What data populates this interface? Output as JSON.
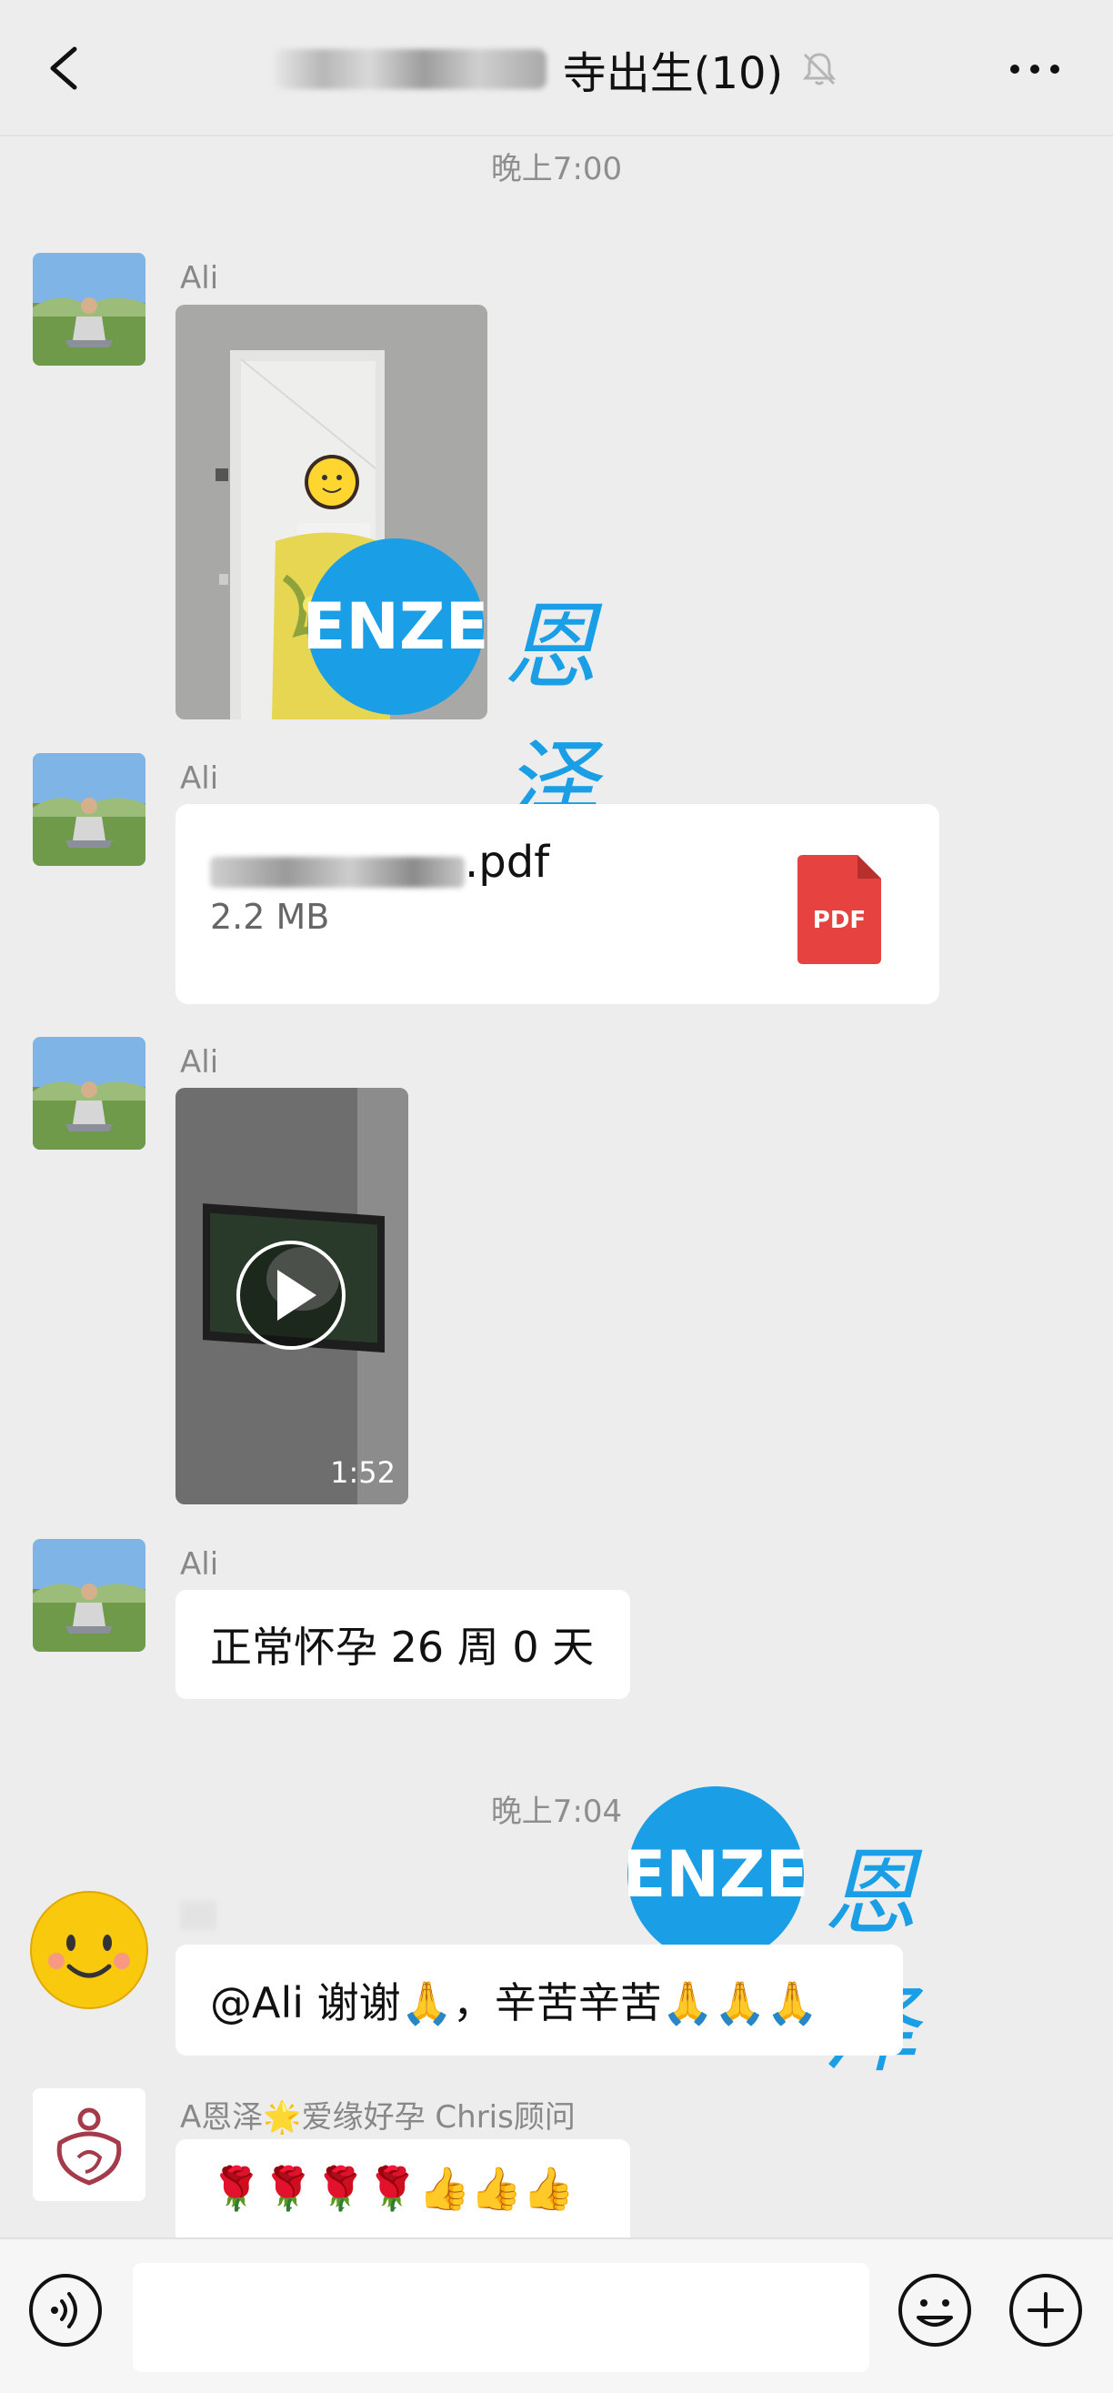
{
  "header": {
    "title_suffix": "寺出生(10)",
    "back_icon": "chevron-left-icon",
    "mute_icon": "bell-off-icon",
    "more_icon": "more-dots-icon"
  },
  "messages": {
    "ts1": "晚上7:00",
    "m1": {
      "sender": "Ali",
      "type": "image"
    },
    "m2": {
      "sender": "Ali",
      "file_ext": ".pdf",
      "file_size": "2.2 MB",
      "file_icon": "PDF"
    },
    "m3": {
      "sender": "Ali",
      "duration": "1:52"
    },
    "m4": {
      "sender": "Ali",
      "text": "正常怀孕 26 周 0 天"
    },
    "ts2": "晚上7:04",
    "m5": {
      "sender": "",
      "text": "@Ali  谢谢🙏，辛苦辛苦🙏🙏🙏"
    },
    "m6": {
      "sender": "A恩泽🌟爱缘好孕 Chris顾问",
      "text": "🌹🌹🌹🌹👍👍👍"
    }
  },
  "watermark": {
    "logo": "ENZE",
    "cn": "恩泽"
  },
  "input_bar": {
    "voice_icon": "voice-icon",
    "emoji_icon": "emoji-icon",
    "plus_icon": "plus-icon",
    "placeholder": ""
  },
  "colors": {
    "background": "#ededed",
    "bubble": "#ffffff",
    "pdf_red": "#e64340",
    "watermark_blue": "#1a9ee6"
  }
}
